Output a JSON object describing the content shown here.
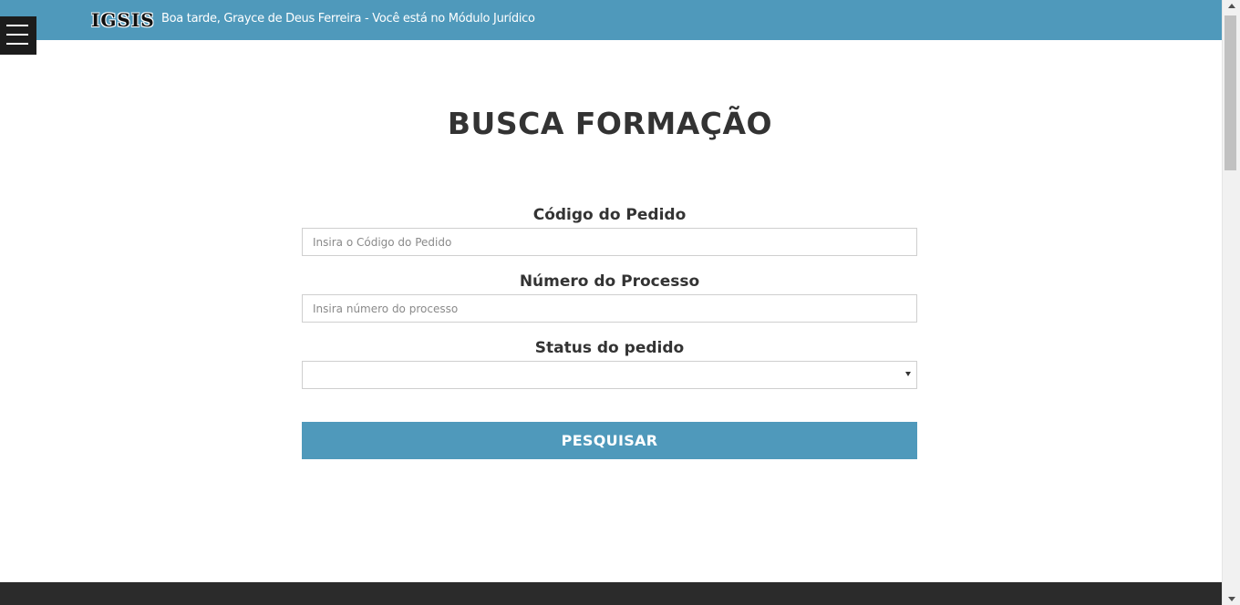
{
  "header": {
    "logo": "IGSIS",
    "greeting": "Boa tarde, Grayce de Deus Ferreira - Você está no Módulo Jurídico",
    "menu_icon": "hamburger-menu-icon",
    "background_color": "#4f99bb"
  },
  "page": {
    "title": "BUSCA FORMAÇÃO"
  },
  "form": {
    "codigo": {
      "label": "Código do Pedido",
      "value": "",
      "placeholder": "Insira o Código do Pedido"
    },
    "processo": {
      "label": "Número do Processo",
      "value": "",
      "placeholder": "Insira número do processo"
    },
    "status": {
      "label": "Status do pedido",
      "selected": ""
    },
    "submit_label": "PESQUISAR",
    "submit_color": "#4f99bb"
  },
  "footer": {
    "background_color": "#2b2b2b"
  }
}
